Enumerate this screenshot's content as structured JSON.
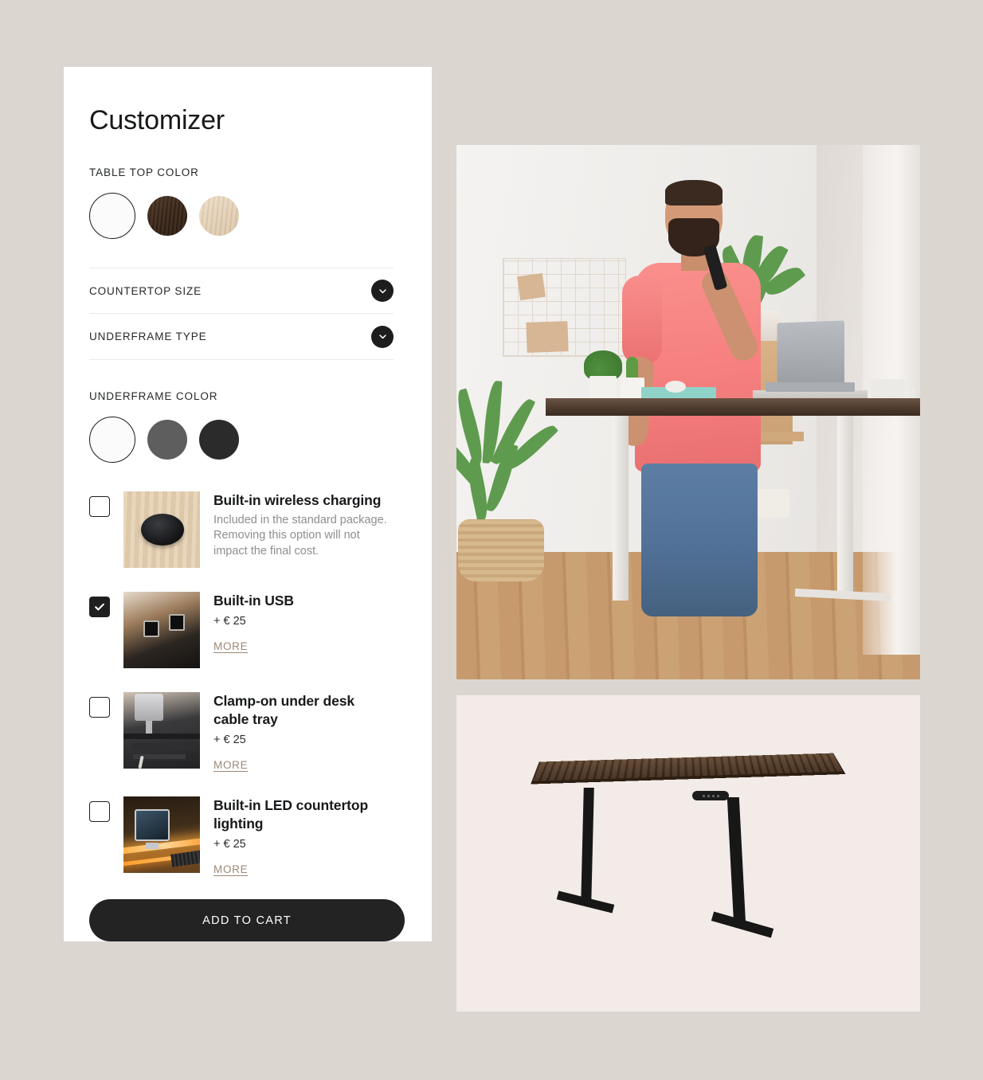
{
  "page": {
    "background_color": "#dcd6d0",
    "card_background": "#ffffff",
    "title": "Customizer"
  },
  "table_top_color": {
    "label": "TABLE TOP COLOR",
    "swatches": [
      {
        "name": "white",
        "color": "#fbfbfb",
        "selected": true
      },
      {
        "name": "dark-walnut",
        "color": "#3a2618",
        "selected": false
      },
      {
        "name": "light-oak",
        "color": "#e1cdb2",
        "selected": false
      }
    ]
  },
  "accordions": [
    {
      "label": "COUNTERTOP SIZE",
      "icon": "chevron-down-icon",
      "expanded": false
    },
    {
      "label": "UNDERFRAME TYPE",
      "icon": "chevron-down-icon",
      "expanded": false
    }
  ],
  "underframe_color": {
    "label": "UNDERFRAME COLOR",
    "swatches": [
      {
        "name": "white",
        "color": "#fbfbfb",
        "selected": true
      },
      {
        "name": "gray",
        "color": "#5e5e5e",
        "selected": false
      },
      {
        "name": "black",
        "color": "#2b2b2b",
        "selected": false
      }
    ]
  },
  "options": [
    {
      "title": "Built-in wireless charging",
      "description": "Included in the standard package. Removing this option will not impact the final cost.",
      "price": "",
      "more_label": "",
      "checked": false,
      "thumbnail": "wireless-charging-pad-on-wood"
    },
    {
      "title": "Built-in USB",
      "description": "",
      "price": "+ € 25",
      "more_label": "MORE",
      "checked": true,
      "thumbnail": "usb-ports-in-desk-edge"
    },
    {
      "title": "Clamp-on under desk cable tray",
      "description": "",
      "price": "+ € 25",
      "more_label": "MORE",
      "checked": false,
      "thumbnail": "under-desk-cable-tray"
    },
    {
      "title": "Built-in LED countertop lighting",
      "description": "",
      "price": "+ € 25",
      "more_label": "MORE",
      "checked": false,
      "thumbnail": "led-lit-desk-with-imac"
    }
  ],
  "cart": {
    "label": "ADD TO CART",
    "background_color": "#232323",
    "text_color": "#ffffff"
  },
  "media": {
    "lifestyle_photo": {
      "name": "man-on-phone-at-standing-desk",
      "alt": "Smiling bearded man in pink t-shirt talking on phone beside a height adjustable standing desk in a bright room with plants"
    },
    "product_photo": {
      "name": "walnut-standing-desk-product-shot",
      "alt": "Dark walnut standing desk with black T-shaped underframe and control panel",
      "background_color": "#f2ebe7"
    }
  },
  "colors": {
    "accent_more_link": "#9c8877",
    "title_text": "#16181a",
    "description_text": "#8e8e8e",
    "divider": "#e9e9e9"
  }
}
